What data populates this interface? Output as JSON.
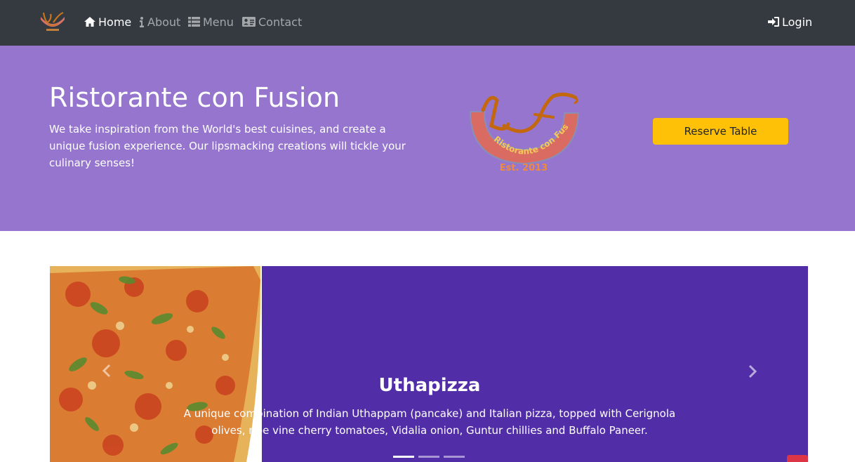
{
  "navbar": {
    "items": [
      {
        "label": "Home",
        "icon": "home-icon",
        "active": true
      },
      {
        "label": "About",
        "icon": "info-icon",
        "active": false
      },
      {
        "label": "Menu",
        "icon": "list-icon",
        "active": false
      },
      {
        "label": "Contact",
        "icon": "address-card-icon",
        "active": false
      }
    ],
    "login_label": "Login"
  },
  "jumbotron": {
    "title": "Ristorante con Fusion",
    "text": "We take inspiration from the World's best cuisines, and create a unique fusion experience. Our lipsmacking creations will tickle your culinary senses!",
    "logo_text": "Ristorante con Fusion",
    "logo_est": "Est. 2013",
    "reserve_label": "Reserve Table"
  },
  "carousel": {
    "title": "Uthapizza",
    "text": "A unique combination of Indian Uthappam (pancake) and Italian pizza, topped with Cerignola olives, ripe vine cherry tomatoes, Vidalia onion, Guntur chillies and Buffalo Paneer.",
    "active_slide": 1,
    "slide_count": 3
  },
  "colors": {
    "navbar_bg": "#343a40",
    "jumbotron_bg": "#9575cd",
    "carousel_bg": "#512da8",
    "reserve_button": "#ffc107"
  }
}
